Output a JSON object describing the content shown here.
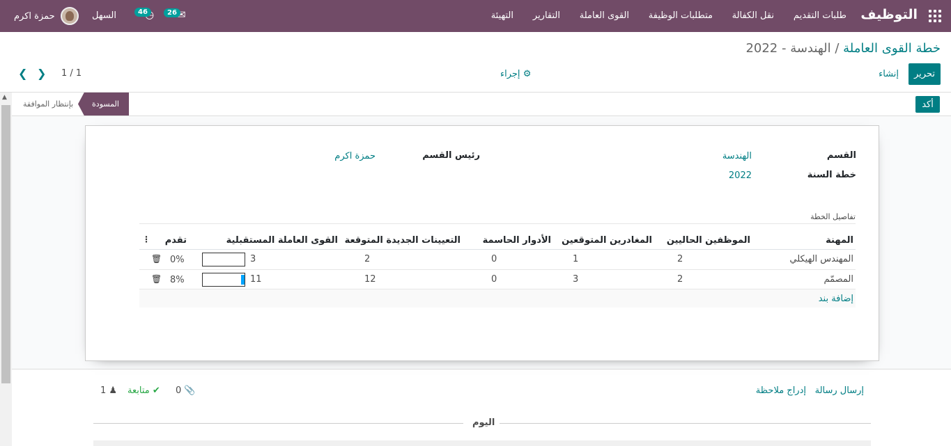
{
  "navbar": {
    "brand": "التوظيف",
    "menu": [
      "طلبات التقديم",
      "نقل الكفالة",
      "متطلبات الوظيفة",
      "القوى العاملة",
      "التقارير",
      "التهيئة"
    ],
    "company": "السهل",
    "user": "حمزة اكرم",
    "messages_count": "26",
    "activities_count": "46"
  },
  "breadcrumb": {
    "parent": "خطة القوى العاملة",
    "separator": " / ",
    "current": "الهندسة - 2022"
  },
  "toolbar": {
    "edit_label": "تحرير",
    "create_label": "إنشاء",
    "action_label": "إجراء",
    "pager_value": "1 / 1"
  },
  "statusbar": {
    "confirm_label": "أكد",
    "stage_current": "المسودة",
    "stage_next": "بإنتظار الموافقة"
  },
  "form": {
    "department_label": "القسم",
    "department_value": "الهندسة",
    "plan_year_label": "خطة السنة",
    "plan_year_value": "2022",
    "manager_label": "رئيس القسم",
    "manager_value": "حمزة اكرم",
    "section_title": "تفاصيل الخطة"
  },
  "table": {
    "headers": [
      "المهنة",
      "الموظفين الحاليين",
      "المغادرين المتوقعين",
      "الأدوار الحاسمة",
      "التعيينات الجديدة المتوقعة",
      "القوى العاملة المستقبلية",
      "تقدم"
    ],
    "rows": [
      {
        "job": "المهندس الهيكلي",
        "current": "2",
        "leaving": "1",
        "critical": "0",
        "new_hires": "2",
        "future": "3",
        "progress": "0%",
        "progress_value": 0
      },
      {
        "job": "المصمّم",
        "current": "2",
        "leaving": "3",
        "critical": "0",
        "new_hires": "12",
        "future": "11",
        "progress": "8%",
        "progress_value": 8
      }
    ],
    "add_line": "إضافة بند"
  },
  "chatter": {
    "send_message": "إرسال رسالة",
    "log_note": "إدراج ملاحظة",
    "attachments": "0",
    "follow": "متابعة",
    "followers": "1",
    "day": "اليوم"
  },
  "colors": {
    "primary": "#714b67",
    "accent": "#017e84",
    "progress": "#00a3ff"
  }
}
